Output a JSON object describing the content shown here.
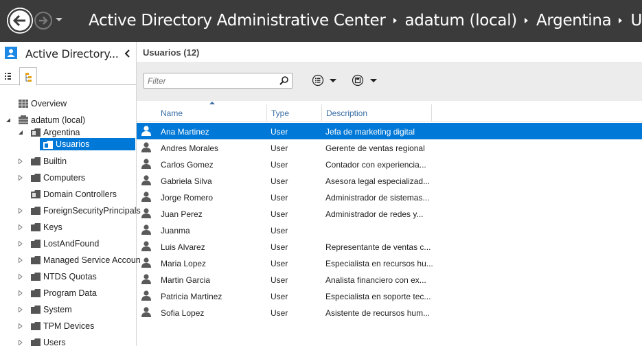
{
  "titlebar": {
    "app_name": "Active Directory Administrative Center",
    "breadcrumbs": [
      "adatum (local)",
      "Argentina",
      "Usuarios"
    ],
    "background": "#3b3b3b"
  },
  "left_panel": {
    "title": "Active Directory...",
    "tree": [
      {
        "label": "Overview",
        "level": 0,
        "expandable": false,
        "icon": "overview-grid-icon"
      },
      {
        "label": "adatum (local)",
        "level": 0,
        "expandable": true,
        "expanded": true,
        "icon": "domain-icon"
      },
      {
        "label": "Argentina",
        "level": 1,
        "expandable": true,
        "expanded": true,
        "icon": "ou-folder-icon"
      },
      {
        "label": "Usuarios",
        "level": 2,
        "expandable": false,
        "selected": true,
        "icon": "ou-folder-icon"
      },
      {
        "label": "Builtin",
        "level": 1,
        "expandable": true,
        "icon": "folder-icon"
      },
      {
        "label": "Computers",
        "level": 1,
        "expandable": true,
        "icon": "folder-icon"
      },
      {
        "label": "Domain Controllers",
        "level": 1,
        "expandable": false,
        "icon": "ou-folder-icon"
      },
      {
        "label": "ForeignSecurityPrincipals",
        "level": 1,
        "expandable": true,
        "icon": "folder-icon"
      },
      {
        "label": "Keys",
        "level": 1,
        "expandable": true,
        "icon": "folder-icon"
      },
      {
        "label": "LostAndFound",
        "level": 1,
        "expandable": true,
        "icon": "folder-icon"
      },
      {
        "label": "Managed Service Accoun",
        "level": 1,
        "expandable": true,
        "icon": "folder-icon"
      },
      {
        "label": "NTDS Quotas",
        "level": 1,
        "expandable": true,
        "icon": "folder-icon"
      },
      {
        "label": "Program Data",
        "level": 1,
        "expandable": true,
        "icon": "folder-icon"
      },
      {
        "label": "System",
        "level": 1,
        "expandable": true,
        "icon": "folder-icon"
      },
      {
        "label": "TPM Devices",
        "level": 1,
        "expandable": true,
        "icon": "folder-icon"
      },
      {
        "label": "Users",
        "level": 1,
        "expandable": true,
        "icon": "folder-icon"
      }
    ]
  },
  "main": {
    "title": "Usuarios",
    "count": "(12)",
    "filter_placeholder": "Filter",
    "columns": [
      "Name",
      "Type",
      "Description"
    ],
    "sort_column": "Name",
    "rows": [
      {
        "name": "Ana Martinez",
        "type": "User",
        "description": "Jefa de marketing digital",
        "selected": true
      },
      {
        "name": "Andres Morales",
        "type": "User",
        "description": "Gerente de ventas regional"
      },
      {
        "name": "Carlos Gomez",
        "type": "User",
        "description": "Contador con experiencia..."
      },
      {
        "name": "Gabriela Silva",
        "type": "User",
        "description": "Asesora legal especializad..."
      },
      {
        "name": "Jorge Romero",
        "type": "User",
        "description": "Administrador de sistemas..."
      },
      {
        "name": "Juan Perez",
        "type": "User",
        "description": "Administrador de redes y..."
      },
      {
        "name": "Juanma",
        "type": "User",
        "description": ""
      },
      {
        "name": "Luis Alvarez",
        "type": "User",
        "description": "Representante de ventas c..."
      },
      {
        "name": "Maria Lopez",
        "type": "User",
        "description": "Especialista en recursos hu..."
      },
      {
        "name": "Martin Garcia",
        "type": "User",
        "description": "Analista financiero con ex..."
      },
      {
        "name": "Patricia Martinez",
        "type": "User",
        "description": "Especialista en soporte tec..."
      },
      {
        "name": "Sofia Lopez",
        "type": "User",
        "description": "Asistente de recursos hum..."
      }
    ]
  },
  "colors": {
    "selection": "#0078d7",
    "header_text": "#3a6ea5",
    "toolbar": "#ececec"
  }
}
